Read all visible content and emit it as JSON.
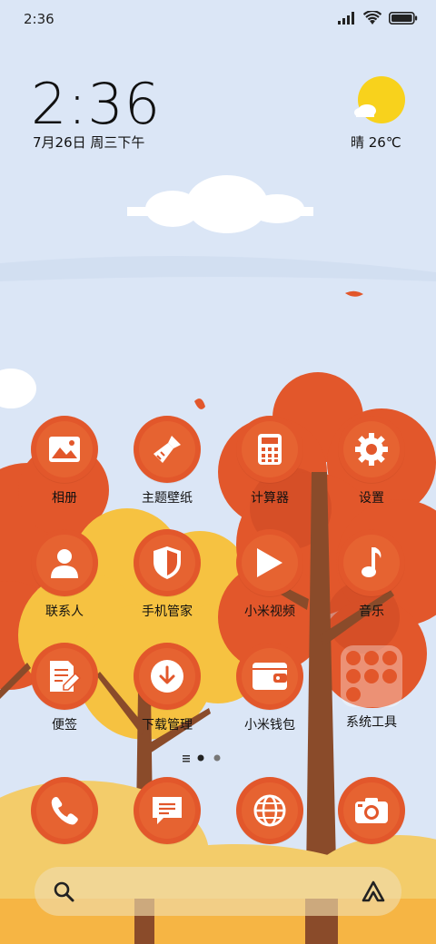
{
  "status_bar": {
    "time": "2:36"
  },
  "lockclock": {
    "time": "2:36",
    "date": "7月26日 周三下午"
  },
  "weather": {
    "text": "晴 26℃",
    "icon": "sun-cloud-icon"
  },
  "apps": [
    {
      "label": "相册",
      "icon": "gallery-icon"
    },
    {
      "label": "主题壁纸",
      "icon": "brush-icon"
    },
    {
      "label": "计算器",
      "icon": "calculator-icon"
    },
    {
      "label": "设置",
      "icon": "gear-icon"
    },
    {
      "label": "联系人",
      "icon": "contact-icon"
    },
    {
      "label": "手机管家",
      "icon": "shield-icon"
    },
    {
      "label": "小米视频",
      "icon": "play-icon"
    },
    {
      "label": "音乐",
      "icon": "music-note-icon"
    },
    {
      "label": "便签",
      "icon": "note-pencil-icon"
    },
    {
      "label": "下载管理",
      "icon": "download-icon"
    },
    {
      "label": "小米钱包",
      "icon": "wallet-icon"
    },
    {
      "label": "系统工具",
      "icon": "folder-icon"
    }
  ],
  "dock": [
    {
      "label": "",
      "icon": "phone-icon"
    },
    {
      "label": "",
      "icon": "message-icon"
    },
    {
      "label": "",
      "icon": "browser-globe-icon"
    },
    {
      "label": "",
      "icon": "camera-icon"
    }
  ],
  "search": {
    "icon": "search-icon",
    "assistant_icon": "assistant-icon"
  },
  "colors": {
    "accent": "#e2572b",
    "sky": "#dbe6f6",
    "yellow": "#f6c241",
    "trunk": "#8a4b2a"
  }
}
